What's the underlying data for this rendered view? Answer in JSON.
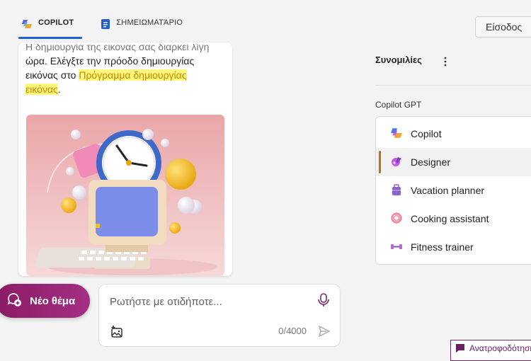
{
  "tabs": [
    {
      "label": "COPILOT",
      "icon": "copilot-icon",
      "active": true
    },
    {
      "label": "ΣΗΜΕΙΩΜΑΤΆΡΙΟ",
      "icon": "notebook-icon",
      "active": false
    }
  ],
  "header": {
    "signin_label": "Είσοδος"
  },
  "chat": {
    "faded_line": "Η δημιουργία της εικόνας σας διαρκεί λίγη",
    "text_part1": "ώρα. Ελέγξτε την πρόοδο δημιουργίας εικόνας στο ",
    "link_text": "Πρόγραμμα δημιουργίας εικόνας",
    "text_end": "."
  },
  "composer": {
    "new_topic_label": "Νέο θέμα",
    "placeholder": "Ρωτήστε με οτιδήποτε...",
    "char_count": "0/4000"
  },
  "sidebar": {
    "title": "Συνομιλίες",
    "gpt_section_label": "Copilot GPT",
    "items": [
      {
        "label": "Copilot",
        "icon": "copilot-icon",
        "selected": false
      },
      {
        "label": "Designer",
        "icon": "designer-icon",
        "selected": true
      },
      {
        "label": "Vacation planner",
        "icon": "suitcase-icon",
        "selected": false
      },
      {
        "label": "Cooking assistant",
        "icon": "donut-icon",
        "selected": false
      },
      {
        "label": "Fitness trainer",
        "icon": "dumbbell-icon",
        "selected": false
      }
    ]
  },
  "feedback": {
    "label": "Ανατροφοδότηση"
  },
  "colors": {
    "accent_blue": "#1e5fd8",
    "new_topic": "#8b1b66",
    "highlight": "#fff57d",
    "selected_bar": "#b3741b"
  }
}
